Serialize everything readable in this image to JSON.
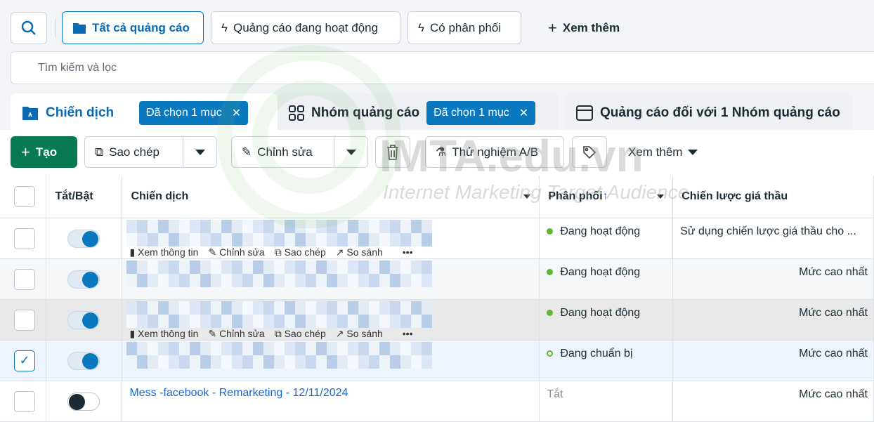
{
  "top_tabs": {
    "all": "Tất cả quảng cáo",
    "active": "Quảng cáo đang hoạt động",
    "delivering": "Có phân phối",
    "more": "Xem thêm"
  },
  "filter": {
    "placeholder": "Tìm kiếm và lọc"
  },
  "levels": {
    "campaigns": {
      "label": "Chiến dịch",
      "chip": "Đã chọn 1 mục"
    },
    "adsets": {
      "label": "Nhóm quảng cáo",
      "chip": "Đã chọn 1 mục"
    },
    "ads": {
      "label": "Quảng cáo đối với 1 Nhóm quảng cáo"
    }
  },
  "toolbar": {
    "create": "Tạo",
    "duplicate": "Sao chép",
    "edit": "Chỉnh sửa",
    "ab_test": "Thử nghiệm A/B",
    "more": "Xem thêm"
  },
  "table": {
    "headers": {
      "toggle": "Tắt/Bật",
      "campaign": "Chiến dịch",
      "delivery": "Phân phối",
      "bid": "Chiến lược giá thầu"
    },
    "row_actions": {
      "view": "Xem thông tin",
      "edit": "Chỉnh sửa",
      "duplicate": "Sao chép",
      "compare": "So sánh",
      "more": "•••"
    },
    "rows": [
      {
        "on": true,
        "checked": false,
        "name": "",
        "delivery": "Đang hoạt động",
        "status": "active",
        "bid": "Sử dụng chiến lược giá thầu cho ..."
      },
      {
        "on": true,
        "checked": false,
        "name": "",
        "delivery": "Đang hoạt động",
        "status": "active",
        "bid": "Mức cao nhất"
      },
      {
        "on": true,
        "checked": false,
        "name": "",
        "delivery": "Đang hoạt động",
        "status": "active",
        "bid": "Mức cao nhất"
      },
      {
        "on": true,
        "checked": true,
        "name": "",
        "delivery": "Đang chuẩn bị",
        "status": "pending",
        "bid": "Mức cao nhất"
      },
      {
        "on": false,
        "checked": false,
        "name": "Mess -facebook - Remarketing - 12/11/2024",
        "delivery": "Tắt",
        "status": "off",
        "bid": "Mức cao nhất"
      }
    ]
  },
  "watermark": {
    "brand": "IMTA.edu.vn",
    "tagline": "Internet Marketing Target Audience"
  },
  "colors": {
    "accent": "#0a78be",
    "create": "#077a52",
    "active_dot": "#5cb82e"
  }
}
